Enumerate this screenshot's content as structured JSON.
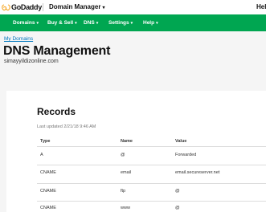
{
  "header": {
    "logo_text": "GoDaddy",
    "app_title": "Domain Manager",
    "app_caret": "▾",
    "help": "Hel"
  },
  "nav": {
    "items": [
      {
        "label": "Domains",
        "caret": "▾"
      },
      {
        "label": "Buy & Sell",
        "caret": "▾"
      },
      {
        "label": "DNS",
        "caret": "▾"
      },
      {
        "label": "Settings",
        "caret": "▾"
      },
      {
        "label": "Help",
        "caret": "▾"
      }
    ]
  },
  "breadcrumb": "My Domains",
  "page_title": "DNS Management",
  "domain": "simayyildizonline.com",
  "records": {
    "title": "Records",
    "last_updated": "Last updated 2/21/18 9:46 AM",
    "columns": [
      "Type",
      "Name",
      "Value"
    ],
    "rows": [
      {
        "type": "A",
        "name": "@",
        "value": "Forwarded"
      },
      {
        "type": "CNAME",
        "name": "email",
        "value": "email.secureserver.net"
      },
      {
        "type": "CNAME",
        "name": "ftp",
        "value": "@"
      },
      {
        "type": "CNAME",
        "name": "www",
        "value": "@"
      }
    ]
  },
  "colors": {
    "nav_green": "#00a651",
    "link_blue": "#0077be",
    "logo_gold": "#f5a623"
  }
}
